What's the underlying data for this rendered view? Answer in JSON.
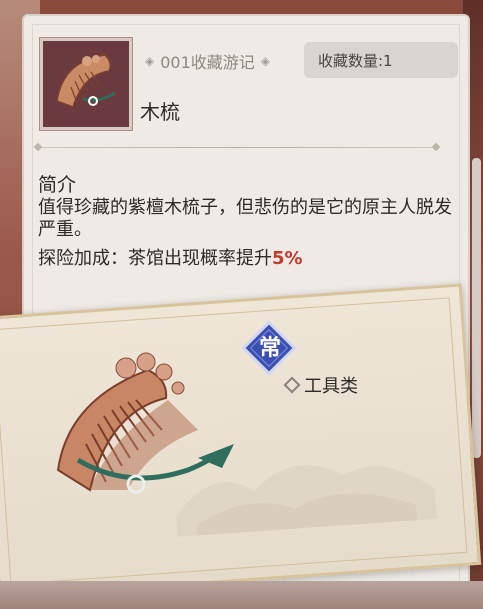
{
  "header": {
    "number_title": "001收藏游记",
    "count_label": "收藏数量:1"
  },
  "item": {
    "name": "木梳",
    "icon": "wooden-comb-icon"
  },
  "description": {
    "heading": "简介",
    "text": "值得珍藏的紫檀木梳子，但悲伤的是它的原主人脱发严重。",
    "bonus_prefix": "探险加成：茶馆出现概率提升",
    "bonus_value": "5%"
  },
  "card": {
    "badge_label": "常",
    "category": "工具类"
  },
  "colors": {
    "accent_red": "#c13a2d",
    "badge_blue": "#3b4fb0",
    "panel_bg": "#efeae6"
  }
}
